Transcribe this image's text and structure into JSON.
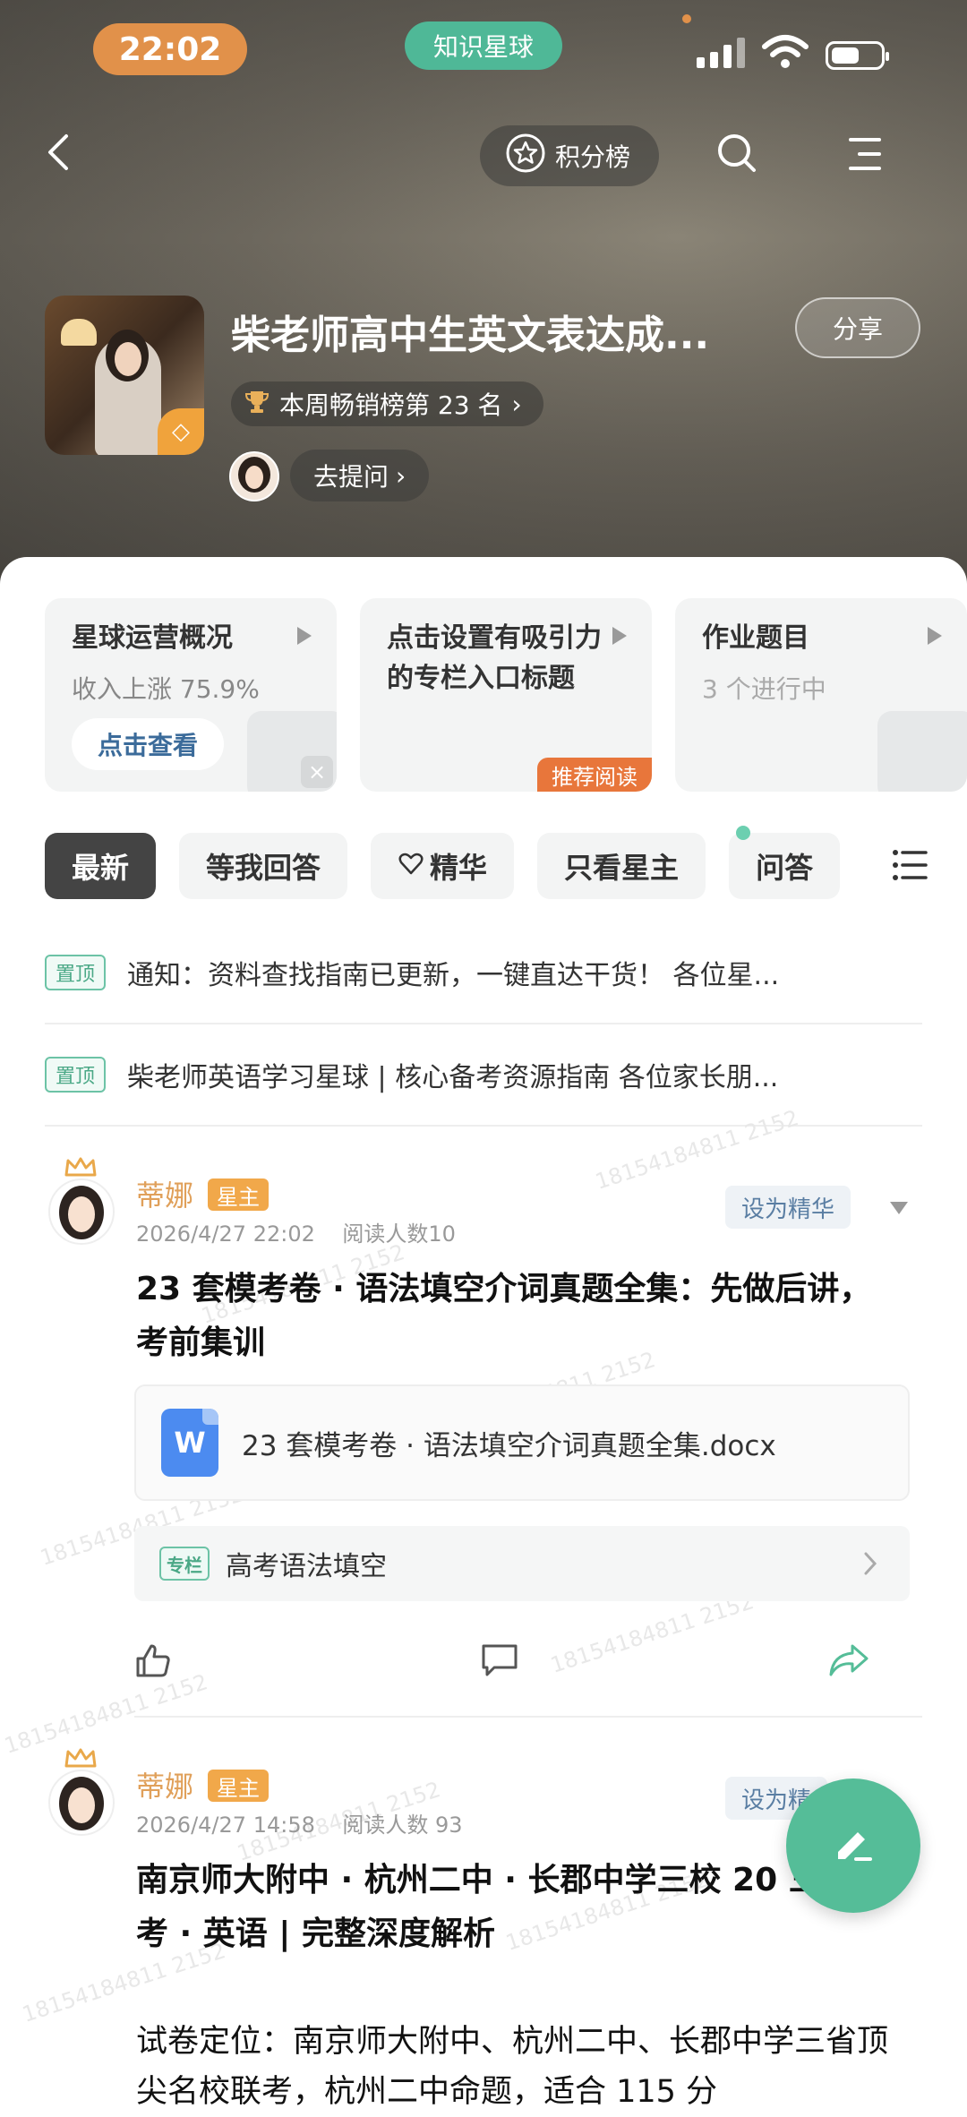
{
  "status_bar": {
    "time": "22:02",
    "app_name": "知识星球"
  },
  "header": {
    "rank_label": "积分榜"
  },
  "group": {
    "title": "柴老师高中生英文表达成...",
    "share_label": "分享",
    "rank_text": "本周畅销榜第 23 名",
    "ask_label": "去提问"
  },
  "cards": [
    {
      "title": "星球运营概况",
      "subtitle": "收入上涨 75.9%",
      "button": "点击查看"
    },
    {
      "title": "点击设置有吸引力的专栏入口标题",
      "tag": "推荐阅读"
    },
    {
      "title": "作业题目",
      "subtitle": "3 个进行中"
    }
  ],
  "tabs": [
    {
      "label": "最新"
    },
    {
      "label": "等我回答"
    },
    {
      "label": "精华"
    },
    {
      "label": "只看星主"
    },
    {
      "label": "问答"
    }
  ],
  "pinned": [
    {
      "tag": "置顶",
      "text": "通知：资料查找指南已更新，一键直达干货！ 各位星..."
    },
    {
      "tag": "置顶",
      "text": "柴老师英语学习星球 | 核心备考资源指南 各位家长朋..."
    }
  ],
  "watermark": "18154184811 2152",
  "posts": [
    {
      "author": "蒂娜",
      "role": "星主",
      "date": "2026/4/27 22:02",
      "reads": "阅读人数10",
      "essence_label": "设为精华",
      "title": "23 套模考卷 · 语法填空介词真题全集：先做后讲，考前集训",
      "file_name": "23 套模考卷 · 语法填空介词真题全集.docx",
      "column_tag": "专栏",
      "column_name": "高考语法填空"
    },
    {
      "author": "蒂娜",
      "role": "星主",
      "date": "2026/4/27 14:58",
      "reads": "阅读人数 93",
      "essence_label": "设为精",
      "title": "南京师大附中 · 杭州二中 · 长郡中学三校 20 三省联考 · 英语 | 完整深度解析",
      "body": "试卷定位：南京师大附中、杭州二中、长郡中学三省顶尖名校联考，杭州二中命题，适合 115 分"
    }
  ],
  "colors": {
    "accent_green": "#55bd98",
    "orange": "#e1914a",
    "owner_tag": "#f1a84a"
  },
  "icons": [
    "back-icon",
    "star-badge-icon",
    "search-icon",
    "menu-icon",
    "trophy-icon",
    "diamond-icon",
    "heart-icon",
    "list-icon",
    "word-file-icon",
    "like-icon",
    "comment-icon",
    "share-icon",
    "edit-icon"
  ]
}
